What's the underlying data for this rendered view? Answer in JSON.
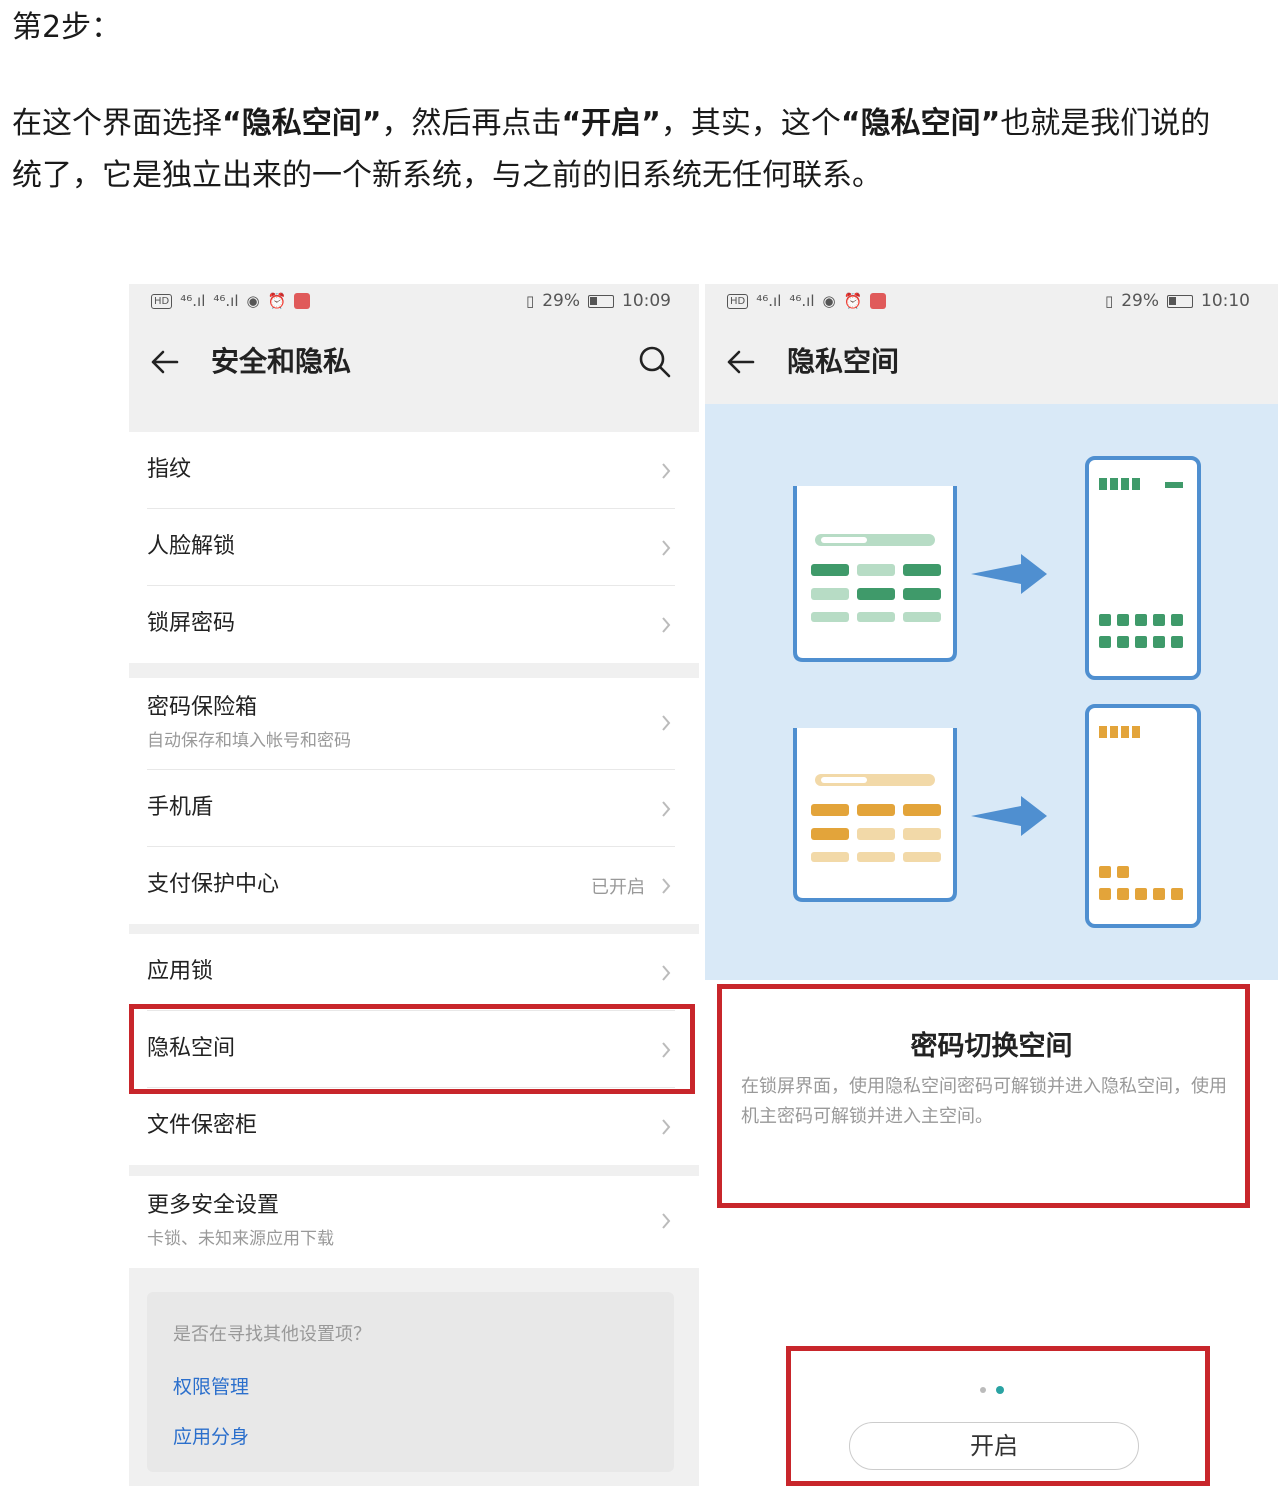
{
  "article": {
    "step": "第2步：",
    "para_p1": "在这个界面选择",
    "para_b1": "“隐私空间”",
    "para_p2": "，然后再点击",
    "para_b2": "“开启”",
    "para_p3": "，其实，这个",
    "para_b3": "“隐私空间”",
    "para_p4": "也就是我们说的",
    "line2": "统了，它是独立出来的一个新系统，与之前的旧系统无任何联系。"
  },
  "left_phone": {
    "status": {
      "signal1": "⁴⁶.ıl",
      "signal2": "⁴⁶.ıl",
      "battery": "29%",
      "time": "10:09"
    },
    "title": "安全和隐私",
    "groups": [
      {
        "items": [
          {
            "label": "指纹"
          },
          {
            "label": "人脸解锁"
          },
          {
            "label": "锁屏密码"
          }
        ]
      },
      {
        "items": [
          {
            "label": "密码保险箱",
            "sub": "自动保存和填入帐号和密码"
          },
          {
            "label": "手机盾"
          },
          {
            "label": "支付保护中心",
            "value": "已开启"
          }
        ]
      },
      {
        "items": [
          {
            "label": "应用锁"
          },
          {
            "label": "隐私空间"
          },
          {
            "label": "文件保密柜"
          }
        ]
      },
      {
        "items": [
          {
            "label": "更多安全设置",
            "sub": "卡锁、未知来源应用下载"
          }
        ]
      }
    ],
    "suggest": {
      "question": "是否在寻找其他设置项？",
      "links": [
        "权限管理",
        "应用分身"
      ]
    }
  },
  "right_phone": {
    "status": {
      "signal1": "⁴⁶.ıl",
      "signal2": "⁴⁶.ıl",
      "battery": "29%",
      "time": "10:10"
    },
    "title": "隐私空间",
    "card": {
      "title": "密码切换空间",
      "desc": "在锁屏界面，使用隐私空间密码可解锁并进入隐私空间，使用机主密码可解锁并进入主空间。"
    },
    "button": "开启"
  },
  "colors": {
    "highlight": "#c8262b",
    "illus_bg": "#d9e9f7",
    "link": "#2b6fcc",
    "green_dark": "#3f9a6a",
    "green_light": "#b7dcc5",
    "orange_dark": "#e3a43a",
    "orange_light": "#f2d9a8",
    "arrow": "#4f8fd0"
  }
}
